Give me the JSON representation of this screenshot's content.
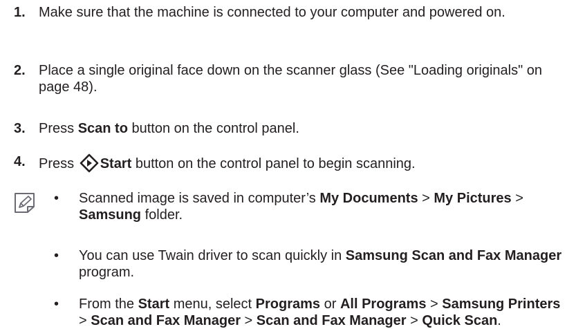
{
  "steps": [
    {
      "num": "1.",
      "text": "Make sure that the machine is connected to your computer and powered on."
    },
    {
      "num": "2.",
      "text": "Place a single original face down on the scanner glass (See \"Loading originals\" on page 48)."
    },
    {
      "num": "3.",
      "pre": "Press ",
      "bold": "Scan to",
      "post": " button on the control panel."
    },
    {
      "num": "4.",
      "pre": "Press ",
      "bold": "Start",
      "post": " button on the control panel to begin scanning.",
      "icon": "start-diamond-icon"
    }
  ],
  "note": {
    "icon": "note-pencil-icon",
    "bullets": [
      {
        "mark": "•",
        "p1": "Scanned image is saved in computer’s ",
        "b1": "My Documents",
        "p2": " > ",
        "b2": "My Pictures",
        "p3": " > ",
        "b3": "Samsung",
        "p4": " folder."
      },
      {
        "mark": "•",
        "p1": "You can use Twain driver to scan quickly in ",
        "b1": "Samsung Scan and Fax Manager",
        "p2": " program."
      },
      {
        "mark": "•",
        "p1": "From the ",
        "b1": "Start",
        "p2": " menu, select ",
        "b2": "Programs",
        "p3": " or ",
        "b3": "All Programs",
        "p4": " > ",
        "b4": "Samsung Printers",
        "p5": " > ",
        "b5": "Scan and Fax Manager",
        "p6": " > ",
        "b6": "Scan and Fax Manager",
        "p7": " > ",
        "b7": "Quick Scan",
        "p8": "."
      }
    ]
  }
}
